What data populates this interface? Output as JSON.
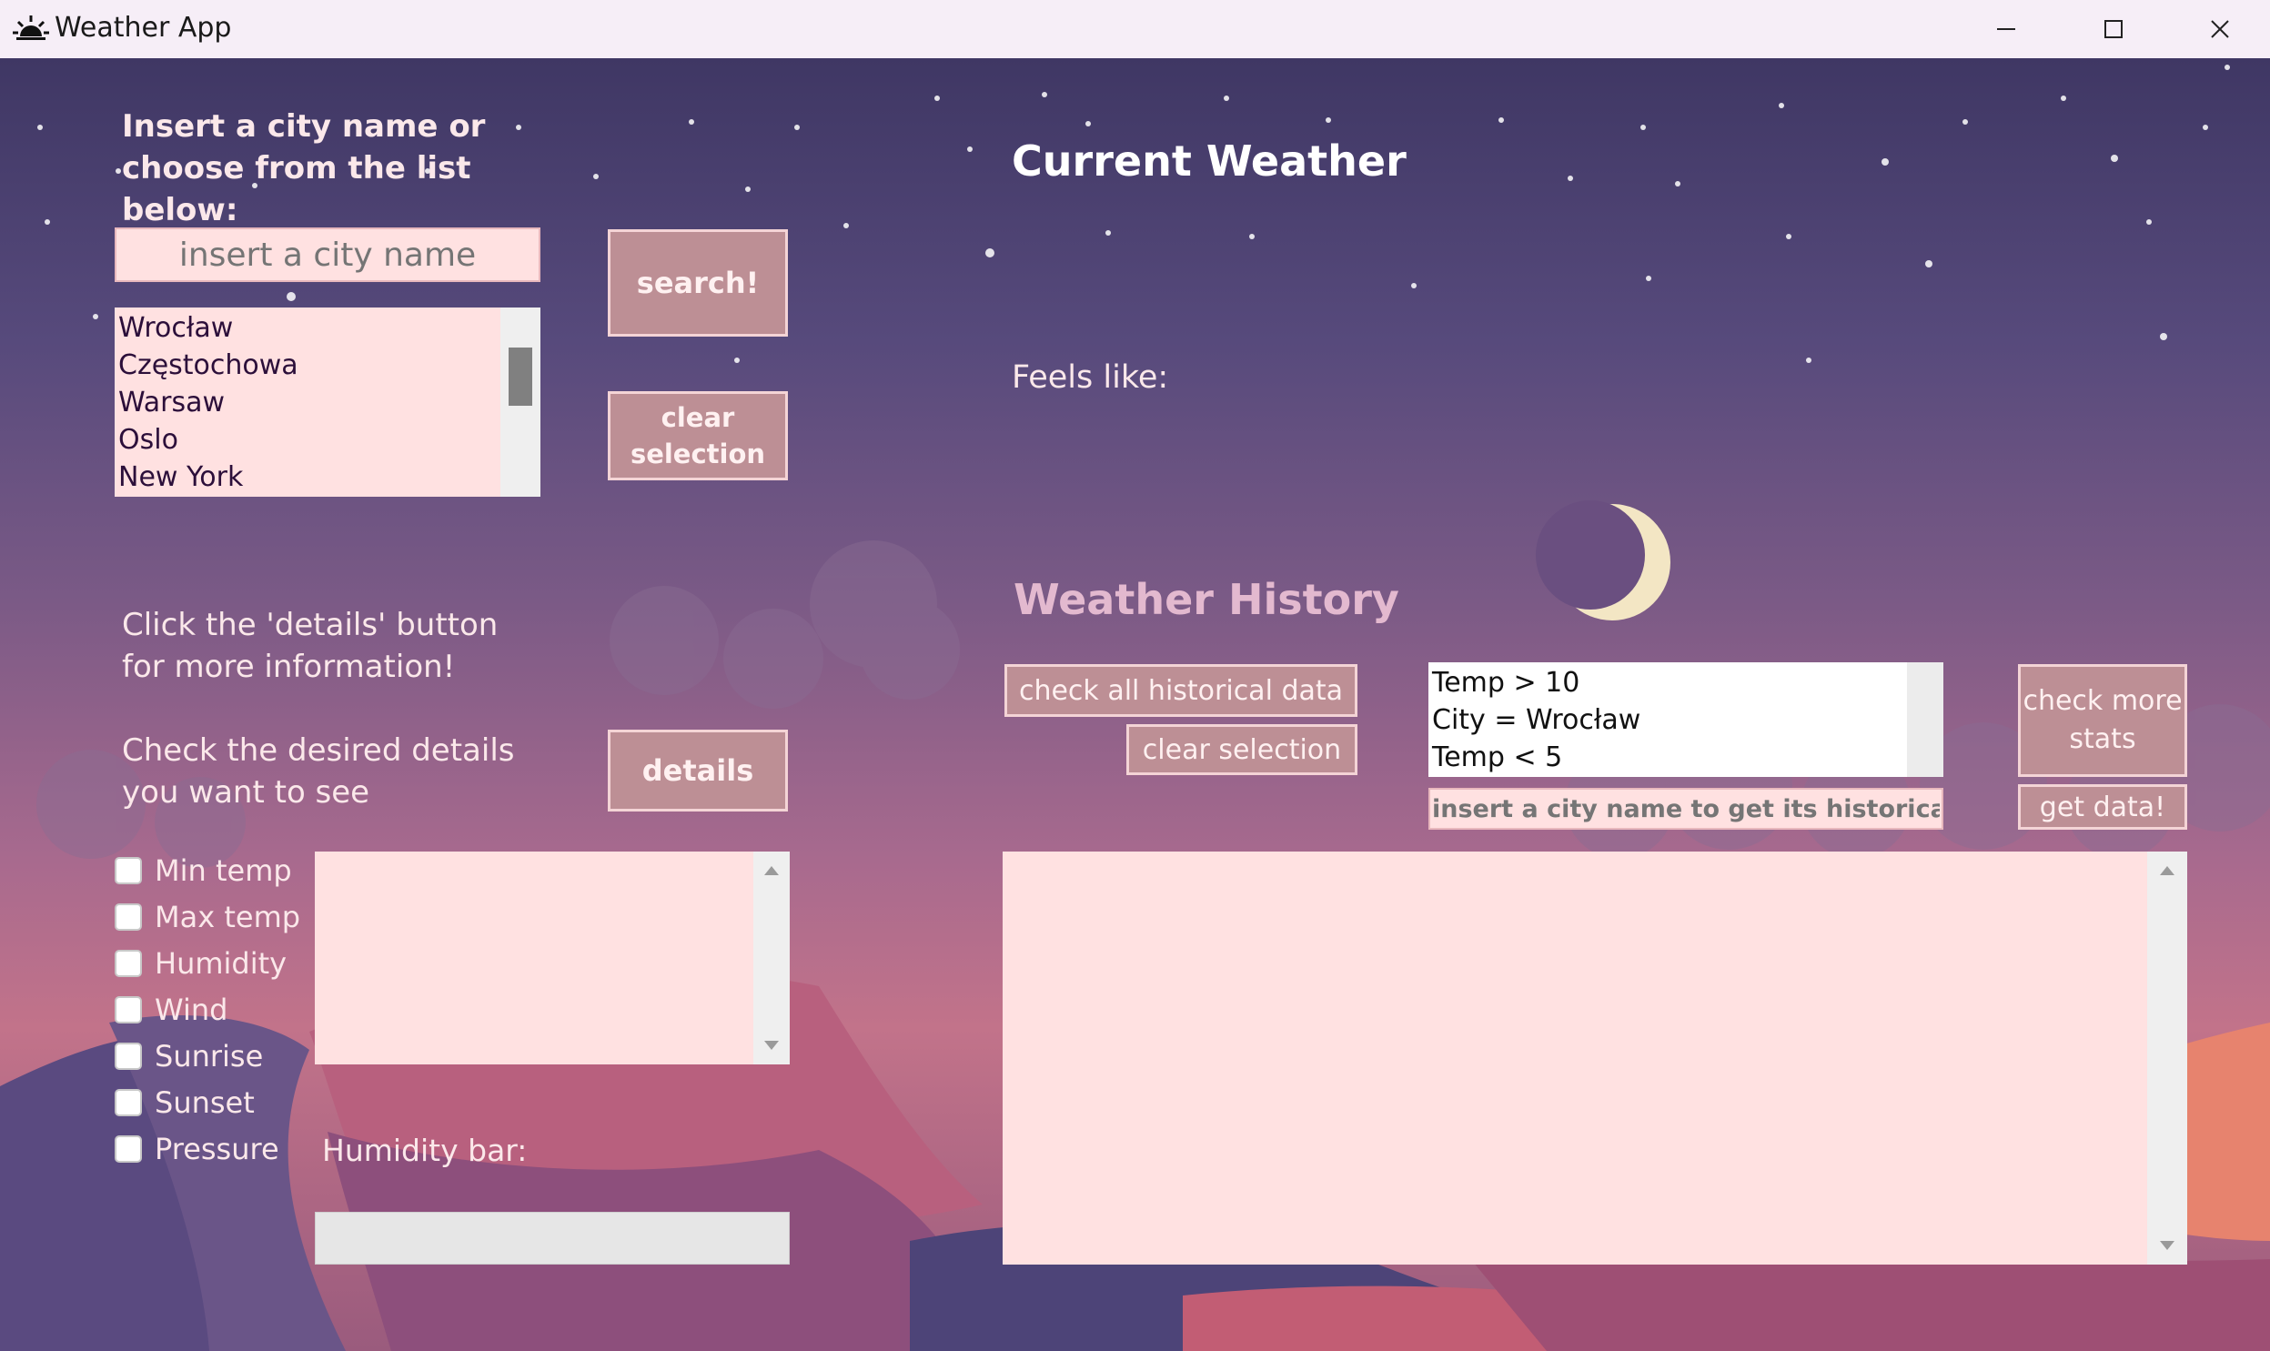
{
  "window": {
    "title": "Weather App"
  },
  "left_panel": {
    "instruction": "Insert a city name or choose from the list below:",
    "city_input_placeholder": "insert a city name",
    "search_label": "search!",
    "clear_selection_label": "clear selection",
    "cities": [
      "Wrocław",
      "Częstochowa",
      "Warsaw",
      "Oslo",
      "New York"
    ],
    "details_hint": "Click the 'details' button for more information!",
    "details_check_hint": "Check the desired details you want to see",
    "details_label": "details",
    "detail_options": [
      "Min temp",
      "Max temp",
      "Humidity",
      "Wind",
      "Sunrise",
      "Sunset",
      "Pressure"
    ],
    "humidity_bar_label": "Humidity bar:",
    "humidity_value": 0
  },
  "right_panel": {
    "current_weather_title": "Current Weather",
    "feels_like_label": "Feels like:",
    "history_title": "Weather History",
    "check_all_label": "check all historical data",
    "clear_selection_label": "clear selection",
    "filters": [
      "Temp > 10",
      "City = Wrocław",
      "Temp < 5"
    ],
    "history_input_placeholder": "insert a city name to get its historical data",
    "check_more_label": "check more stats",
    "get_data_label": "get data!"
  },
  "colors": {
    "sky_top": "#3f3764",
    "sky_bottom": "#c2738a",
    "field_bg": "#ffe1e1",
    "button_bg": "#bd8f95",
    "moon": "#f3e6c4"
  },
  "icons": {
    "app": "sun-icon",
    "minimize": "minimize-icon",
    "maximize": "maximize-icon",
    "close": "close-icon",
    "moon": "moon-icon"
  }
}
